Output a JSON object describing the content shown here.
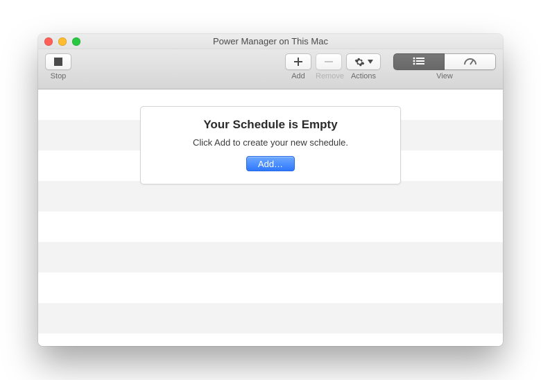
{
  "window": {
    "title": "Power Manager on This Mac"
  },
  "toolbar": {
    "stop_label": "Stop",
    "add_label": "Add",
    "remove_label": "Remove",
    "actions_label": "Actions",
    "view_label": "View"
  },
  "empty": {
    "heading": "Your Schedule is Empty",
    "subtitle": "Click Add to create your new schedule.",
    "button": "Add…"
  },
  "colors": {
    "primary": "#3a7dff"
  }
}
